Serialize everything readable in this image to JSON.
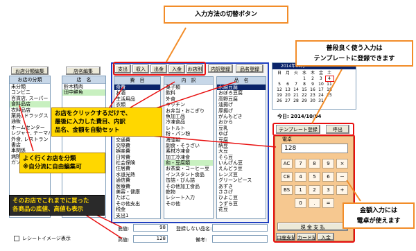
{
  "tooltips": {
    "switch_buttons": "入力方法の切替ボタン",
    "template": "普段良く使う入力は\nテンプレートに登録できます",
    "calculator": "金額入力には\n電卓が使えます"
  },
  "callouts": {
    "auto_set": "お店をクリックするだけで、\n最後に入力した費目、内訳\n品名、金額を自動セット",
    "classify": "よく行くお店を分類\n※自分流に自由編集可",
    "price_range": "そのお店でこれまでに買った\n各商品の底値、高値も表示"
  },
  "shop_category": {
    "edit_button": "お店分類編集",
    "header": "お店の分類",
    "items": [
      "未分類",
      "コンビニ",
      "百貨店, スーパー",
      "食料品店",
      "衣料品店",
      "薬局, ドラッグス",
      "通販",
      "ホームセンター",
      "レジャー, テーマパーク",
      "外食, レストラン",
      "書店",
      "車関係",
      "病院",
      "ガソリン"
    ]
  },
  "shop_name": {
    "edit_button": "店名編集",
    "header": "店　名",
    "items": [
      "鈴木精肉",
      "田中鮮魚"
    ]
  },
  "mode_tabs": [
    "支出",
    "収入",
    "出金",
    "入金",
    "お店別"
  ],
  "category_list": {
    "header": "費　目",
    "items": [
      "食費",
      "お酒",
      "生活用品",
      "衣類",
      "医療",
      "育児・子供教育",
      "住居費",
      "水道光熱費",
      "通信費",
      "交通費",
      "交際費",
      "娯楽費",
      "日常費",
      "社会保険",
      "住居費",
      "水道光熱",
      "通信費",
      "医療費",
      "美容・健康",
      "たばこ",
      "その他支出",
      "税金",
      "支出1",
      "支出2"
    ]
  },
  "detail_list": {
    "header": "内　訳",
    "items": [
      "菓子類",
      "飲料",
      "外食",
      "キッチン",
      "お弁当・おこぎり",
      "魚加工品",
      "冷凍食品",
      "レトルト",
      "粉・パン粉",
      "海藻類",
      "副食・そうざい",
      "素材冷凍食",
      "加工冷凍食",
      "和・豆腐類",
      "お茶葉・コーヒー豆",
      "インスタント食品",
      "缶詰・びん詰",
      "その他加工食品",
      "乾物",
      "レシート入力",
      "その他"
    ]
  },
  "item_list": {
    "reg_button": "内訳登録",
    "item_reg_button": "品名登録",
    "header": "品　名",
    "items": [
      "木綿豆腐",
      "おぼろ豆腐",
      "高野豆腐",
      "油揚げ",
      "厚揚げ",
      "がんもどき",
      "おから",
      "豆乳",
      "ゆば",
      "豆腐",
      "納豆",
      "大豆",
      "そら豆",
      "いんげん豆",
      "えんどう豆",
      "レンズ豆",
      "グリーンピース",
      "あずき",
      "ささげ",
      "ひよこ豆",
      "うずら豆",
      "花豆"
    ]
  },
  "calendar": {
    "month_label": "2014年10月",
    "weekdays": [
      "日",
      "月",
      "火",
      "水",
      "木",
      "金",
      "土"
    ],
    "today_label": "今日: 2014/10/04"
  },
  "template_buttons": {
    "register": "テンプレート登録",
    "recall": "呼出"
  },
  "calculator": {
    "title": "電卓",
    "display": "128",
    "keys": [
      [
        "AC",
        "7",
        "8",
        "9",
        "×"
      ],
      [
        "CE",
        "4",
        "5",
        "6",
        "－"
      ],
      [
        "BS",
        "1",
        "2",
        "3",
        "+"
      ],
      [
        "",
        "0",
        ".",
        "=",
        ""
      ]
    ]
  },
  "bottom": {
    "floor_label": "底値:",
    "floor_value": "98",
    "high_label": "高値:",
    "high_value": "128",
    "unregistered_label": "登録しない品名:",
    "memo_label": "備考:",
    "receipt_check": "レシートイメージ表示",
    "cash_button": "現 金 支 払",
    "account_button": "口座支払",
    "card_button": "カード払",
    "income_button": "入金"
  }
}
